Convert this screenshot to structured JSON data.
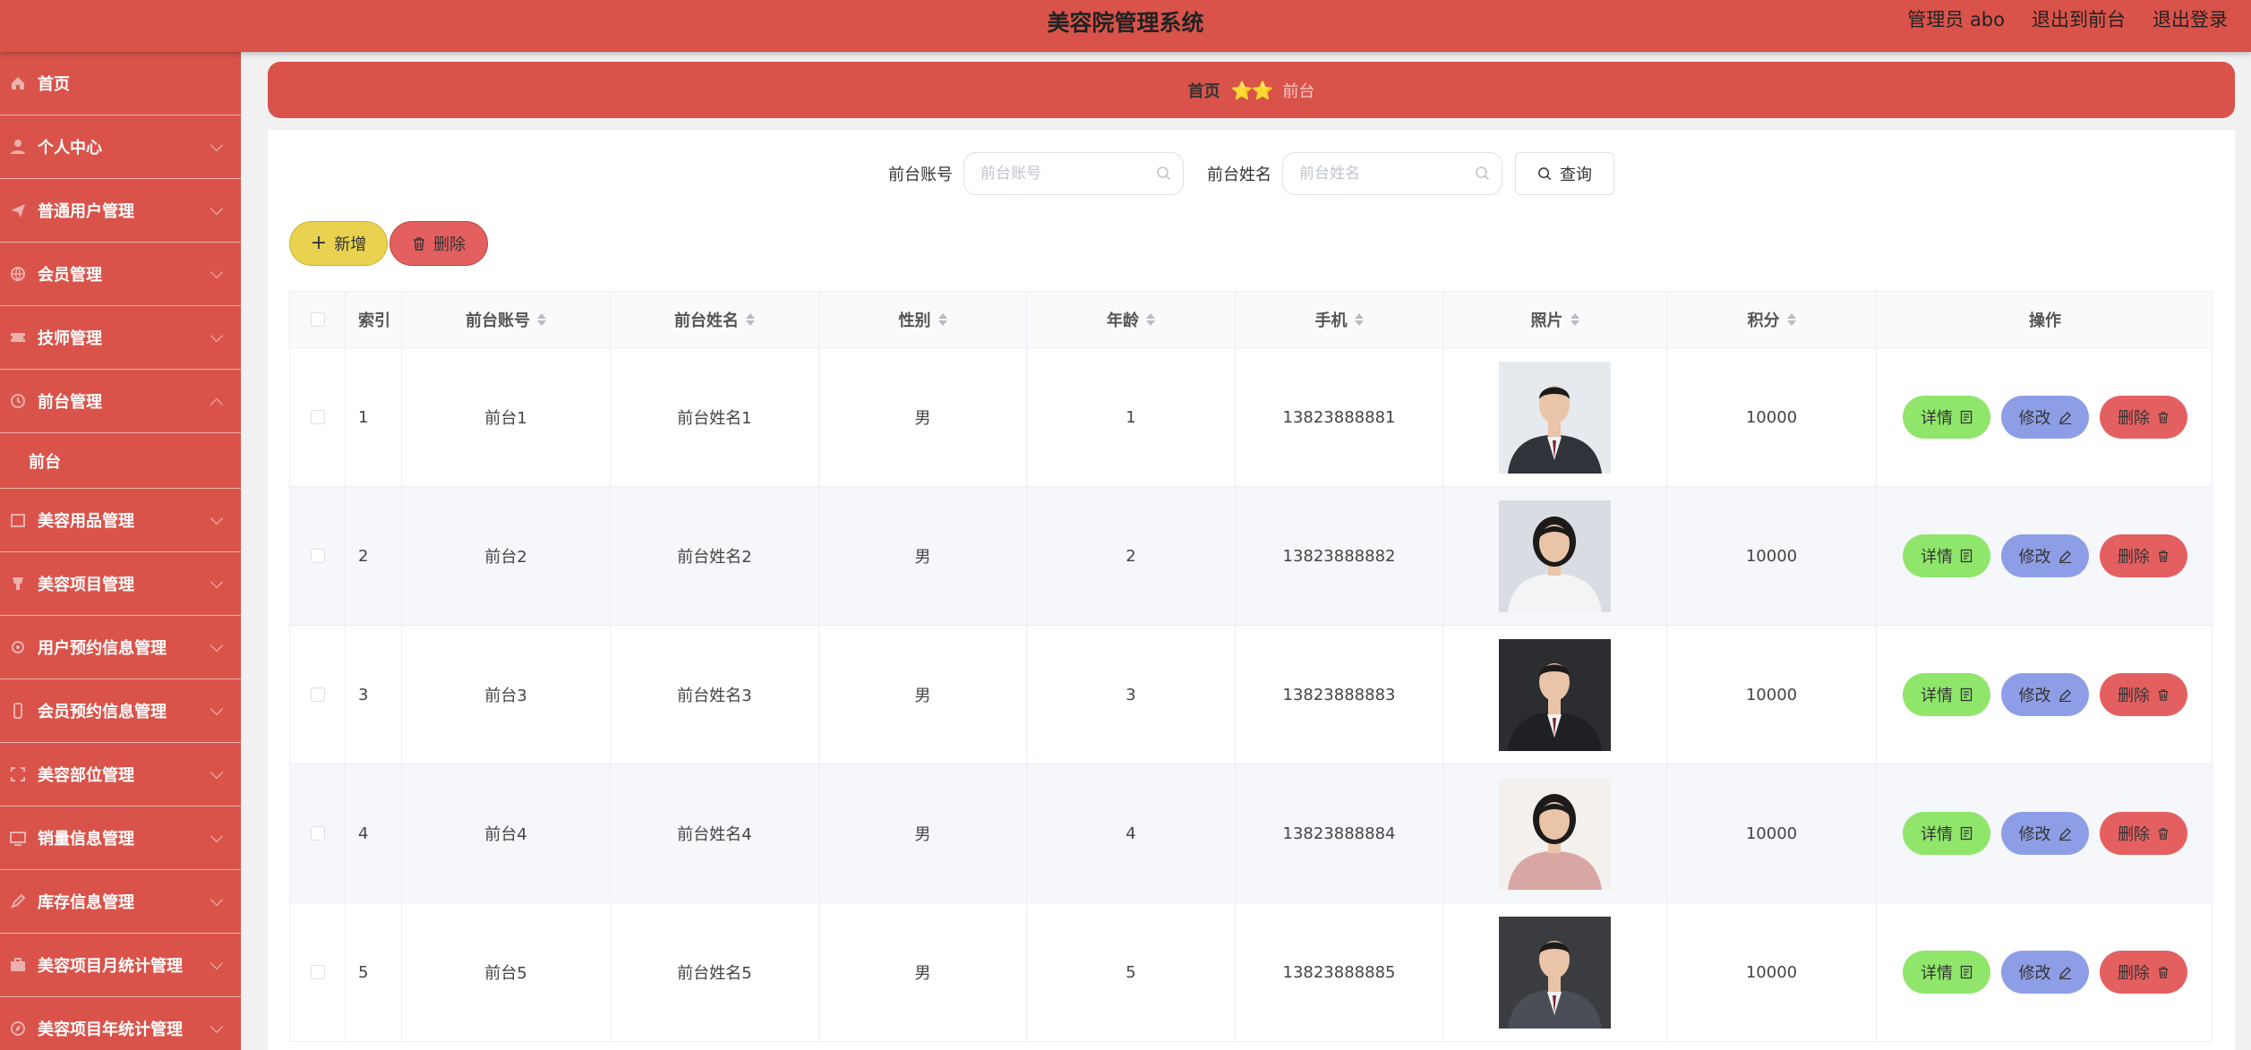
{
  "header": {
    "title": "美容院管理系统",
    "admin": "管理员 abo",
    "to_front": "退出到前台",
    "logout": "退出登录"
  },
  "sidebar": {
    "items": [
      {
        "label": "首页",
        "icon": "home-icon",
        "chevron": "none"
      },
      {
        "label": "个人中心",
        "icon": "user-icon",
        "chevron": "down"
      },
      {
        "label": "普通用户管理",
        "icon": "send-icon",
        "chevron": "down"
      },
      {
        "label": "会员管理",
        "icon": "globe-icon",
        "chevron": "down"
      },
      {
        "label": "技师管理",
        "icon": "ticket-icon",
        "chevron": "down"
      },
      {
        "label": "前台管理",
        "icon": "clock-icon",
        "chevron": "up"
      },
      {
        "label": "美容用品管理",
        "icon": "box-icon",
        "chevron": "down"
      },
      {
        "label": "美容项目管理",
        "icon": "cup-icon",
        "chevron": "down"
      },
      {
        "label": "用户预约信息管理",
        "icon": "sun-icon",
        "chevron": "down"
      },
      {
        "label": "会员预约信息管理",
        "icon": "phone-icon",
        "chevron": "down"
      },
      {
        "label": "美容部位管理",
        "icon": "frame-icon",
        "chevron": "down"
      },
      {
        "label": "销量信息管理",
        "icon": "monitor-icon",
        "chevron": "down"
      },
      {
        "label": "库存信息管理",
        "icon": "pen-icon",
        "chevron": "down"
      },
      {
        "label": "美容项目月统计管理",
        "icon": "briefcase-icon",
        "chevron": "down"
      },
      {
        "label": "美容项目年统计管理",
        "icon": "compass-icon",
        "chevron": "down"
      }
    ],
    "submenu": "前台"
  },
  "breadcrumb": {
    "home": "首页",
    "separator": "⭐⭐",
    "current": "前台"
  },
  "search": {
    "account_label": "前台账号",
    "account_placeholder": "前台账号",
    "account_value": "",
    "name_label": "前台姓名",
    "name_placeholder": "前台姓名",
    "name_value": "",
    "query_label": "查询"
  },
  "toolbar": {
    "add_label": "新增",
    "delete_label": "删除"
  },
  "table": {
    "headers": [
      "索引",
      "前台账号",
      "前台姓名",
      "性别",
      "年龄",
      "手机",
      "照片",
      "积分",
      "操作"
    ],
    "rows": [
      {
        "index": "1",
        "account": "前台1",
        "name": "前台姓名1",
        "sex": "男",
        "age": "1",
        "phone": "13823888881",
        "score": "10000"
      },
      {
        "index": "2",
        "account": "前台2",
        "name": "前台姓名2",
        "sex": "男",
        "age": "2",
        "phone": "13823888882",
        "score": "10000"
      },
      {
        "index": "3",
        "account": "前台3",
        "name": "前台姓名3",
        "sex": "男",
        "age": "3",
        "phone": "13823888883",
        "score": "10000"
      },
      {
        "index": "4",
        "account": "前台4",
        "name": "前台姓名4",
        "sex": "男",
        "age": "4",
        "phone": "13823888884",
        "score": "10000"
      },
      {
        "index": "5",
        "account": "前台5",
        "name": "前台姓名5",
        "sex": "男",
        "age": "5",
        "phone": "13823888885",
        "score": "10000"
      }
    ],
    "detail_label": "详情",
    "edit_label": "修改",
    "remove_label": "删除"
  },
  "colors": {
    "primary": "#d9534a",
    "add": "#e8d24f",
    "danger": "#e46060",
    "detail": "#8fe66b",
    "edit": "#8e9ee6"
  }
}
